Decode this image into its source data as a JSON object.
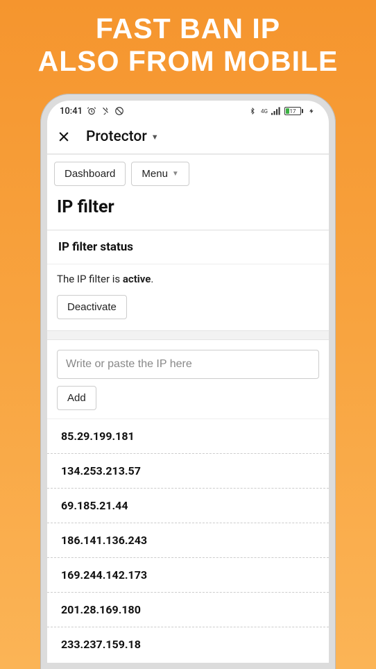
{
  "promo": {
    "line1": "Fast ban IP",
    "line2": "also from mobile"
  },
  "status_bar": {
    "time": "10:41",
    "battery": "17"
  },
  "header": {
    "app_name": "Protector"
  },
  "nav": {
    "dashboard": "Dashboard",
    "menu": "Menu"
  },
  "page": {
    "title": "IP filter",
    "section_title": "IP filter status",
    "status_prefix": "The IP filter is ",
    "status_value": "active",
    "status_suffix": ".",
    "deactivate": "Deactivate"
  },
  "input": {
    "placeholder": "Write or paste the IP here",
    "add": "Add"
  },
  "ips": [
    "85.29.199.181",
    "134.253.213.57",
    "69.185.21.44",
    "186.141.136.243",
    "169.244.142.173",
    "201.28.169.180",
    "233.237.159.18"
  ]
}
